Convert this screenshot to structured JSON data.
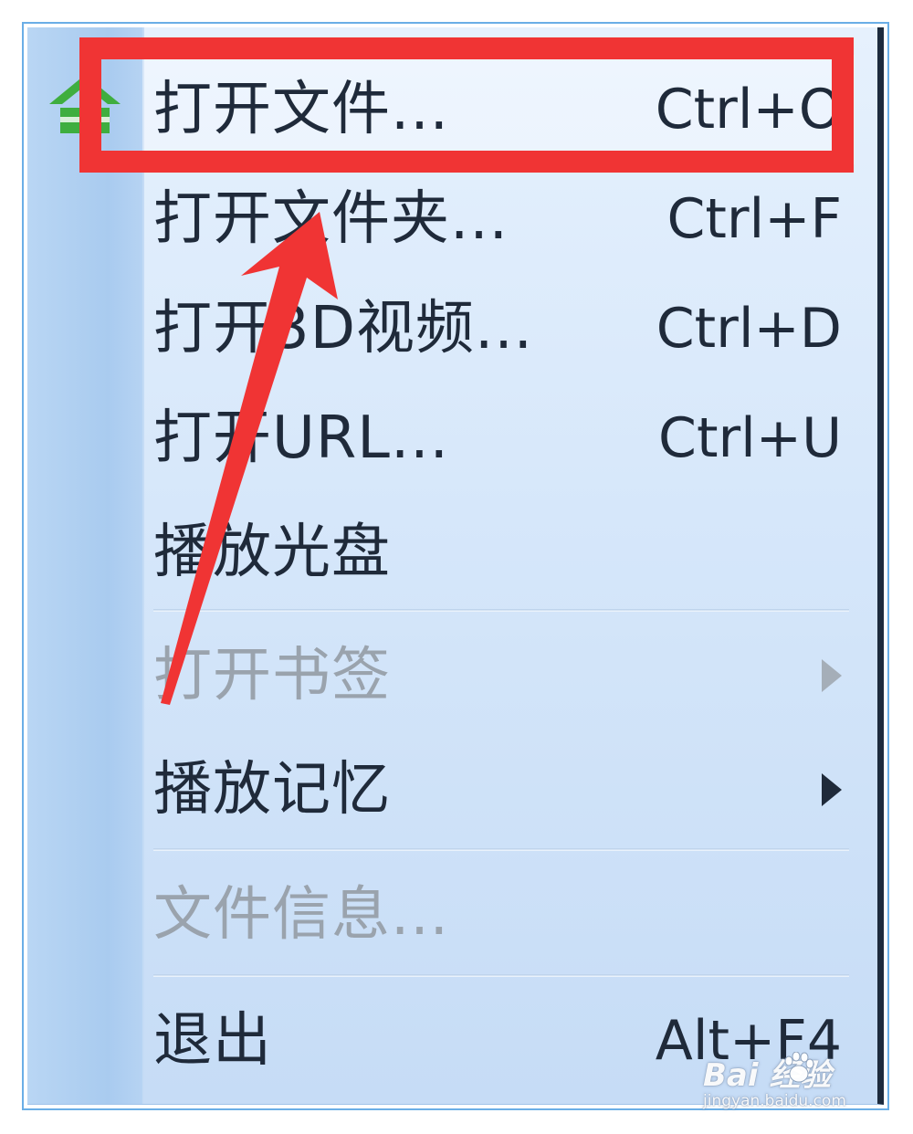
{
  "menu": {
    "items": [
      {
        "label": "打开文件...",
        "shortcut": "Ctrl+O"
      },
      {
        "label": "打开文件夹...",
        "shortcut": "Ctrl+F"
      },
      {
        "label": "打开3D视频...",
        "shortcut": "Ctrl+D"
      },
      {
        "label": "打开URL...",
        "shortcut": "Ctrl+U"
      },
      {
        "label": "播放光盘"
      },
      {
        "label": "打开书签",
        "disabled": true,
        "submenu": true
      },
      {
        "label": "播放记忆",
        "submenu": true
      },
      {
        "label": "文件信息...",
        "disabled": true
      },
      {
        "label": "退出",
        "shortcut": "Alt+F4"
      }
    ]
  },
  "watermark": {
    "brand": "Bai  经验",
    "sub": "jingyan.baidu.com"
  },
  "colors": {
    "annotation_red": "#f03434",
    "menu_text": "#1f2a3a",
    "disabled_text": "#9aa3ad",
    "gutter": "#a9cbef",
    "icon_green": "#3fae3f"
  },
  "icons": {
    "open_file": "house-icon",
    "submenu": "chevron-right-icon"
  }
}
